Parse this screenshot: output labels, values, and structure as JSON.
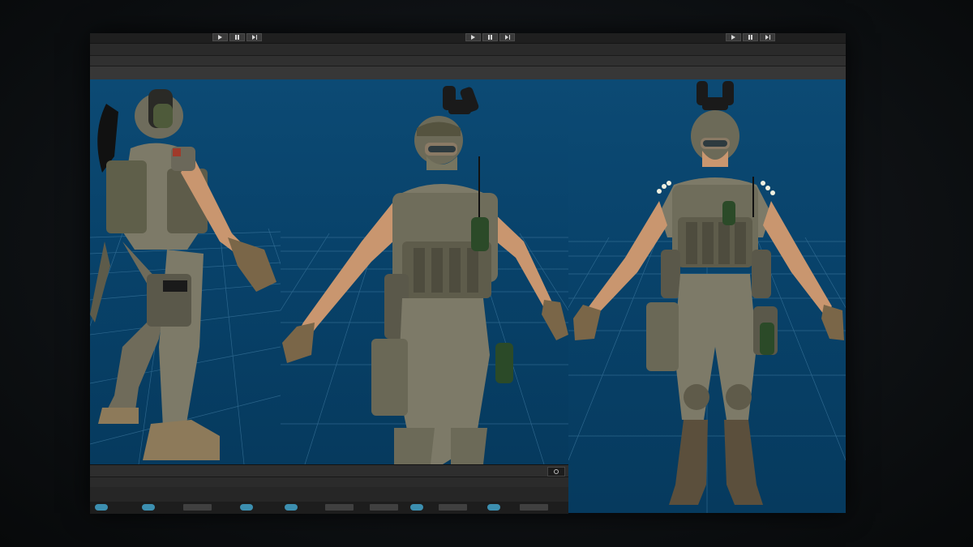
{
  "toolbar": {
    "groups": [
      {
        "buttons": [
          "play",
          "pause",
          "step"
        ]
      },
      {
        "buttons": [
          "play",
          "pause",
          "step"
        ]
      },
      {
        "buttons": [
          "play",
          "pause",
          "step"
        ]
      }
    ]
  },
  "viewports": [
    {
      "view": "back-three-quarter",
      "background": "#0a4670"
    },
    {
      "view": "front-three-quarter",
      "background": "#0a4670"
    },
    {
      "view": "front",
      "background": "#0a4670"
    }
  ],
  "colors": {
    "camo_base": "#7d7a68",
    "camo_dark": "#4f4d40",
    "skin": "#c9966f",
    "glove": "#7a6648",
    "grid": "#4a86ad",
    "viewport_bg": "#0a4670",
    "panel": "#232323"
  },
  "bottom_panel": {
    "search_icon": "magnifier-icon"
  }
}
